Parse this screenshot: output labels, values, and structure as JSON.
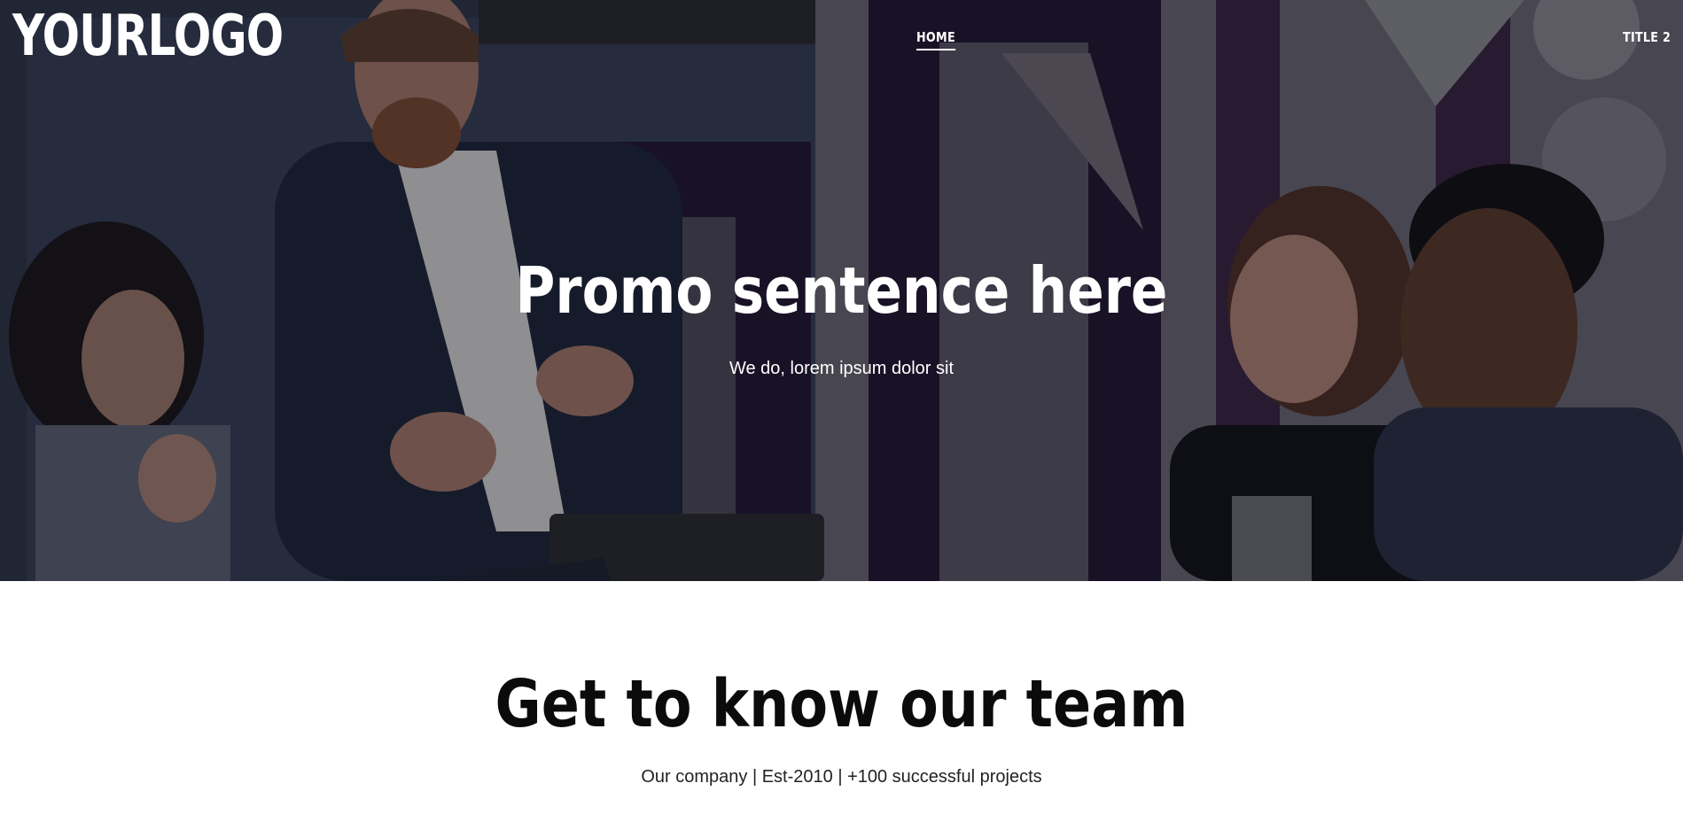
{
  "header": {
    "logo_text": "YOURLOGO",
    "nav": [
      {
        "label": "HOME",
        "active": true
      },
      {
        "label": "TITLE 2",
        "active": false
      }
    ]
  },
  "hero": {
    "headline": "Promo sentence here",
    "subheadline": "We do, lorem ipsum dolor sit",
    "image_description_icon": "team-meeting-photo"
  },
  "team_section": {
    "title": "Get to know our team",
    "subtitle": "Our company | Est-2010 | +100 successful projects"
  },
  "colors": {
    "hero_overlay": "#1a1426",
    "accent_purple": "#2a1838",
    "text_light": "#ffffff",
    "text_dark": "#0b0b0b"
  }
}
